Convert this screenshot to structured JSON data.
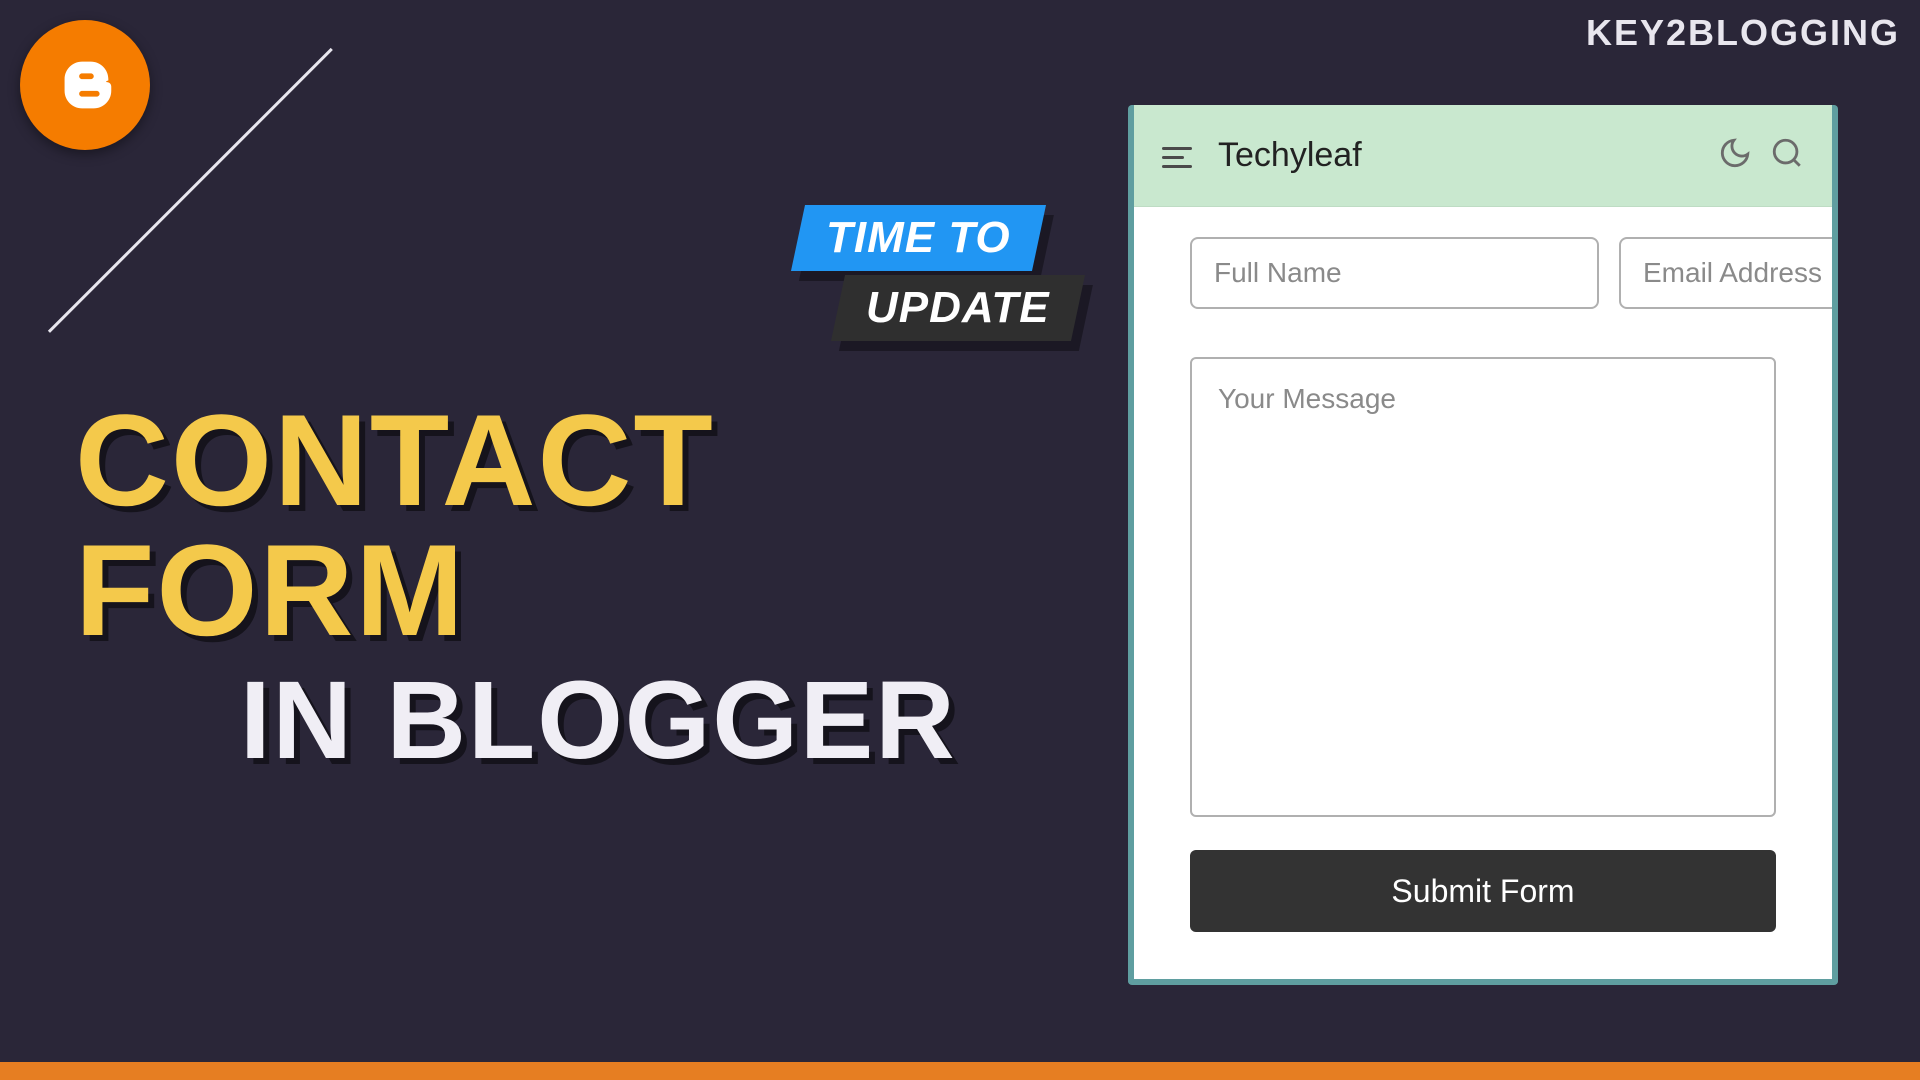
{
  "brand": "KEY2BLOGGING",
  "badge": {
    "line1": "TIME TO",
    "line2": "UPDATE"
  },
  "title": {
    "line1": "CONTACT FORM",
    "line2": "IN BLOGGER"
  },
  "card": {
    "app_title": "Techyleaf",
    "fields": {
      "name_placeholder": "Full Name",
      "email_placeholder": "Email Address",
      "message_placeholder": "Your Message"
    },
    "submit_label": "Submit Form"
  },
  "colors": {
    "background": "#2a2638",
    "accent_orange": "#f57c00",
    "badge_blue": "#2196f3",
    "title_yellow": "#f4c94b",
    "card_header": "#c9e8cf",
    "card_border": "#5f9ea0",
    "submit_bg": "#333333"
  }
}
